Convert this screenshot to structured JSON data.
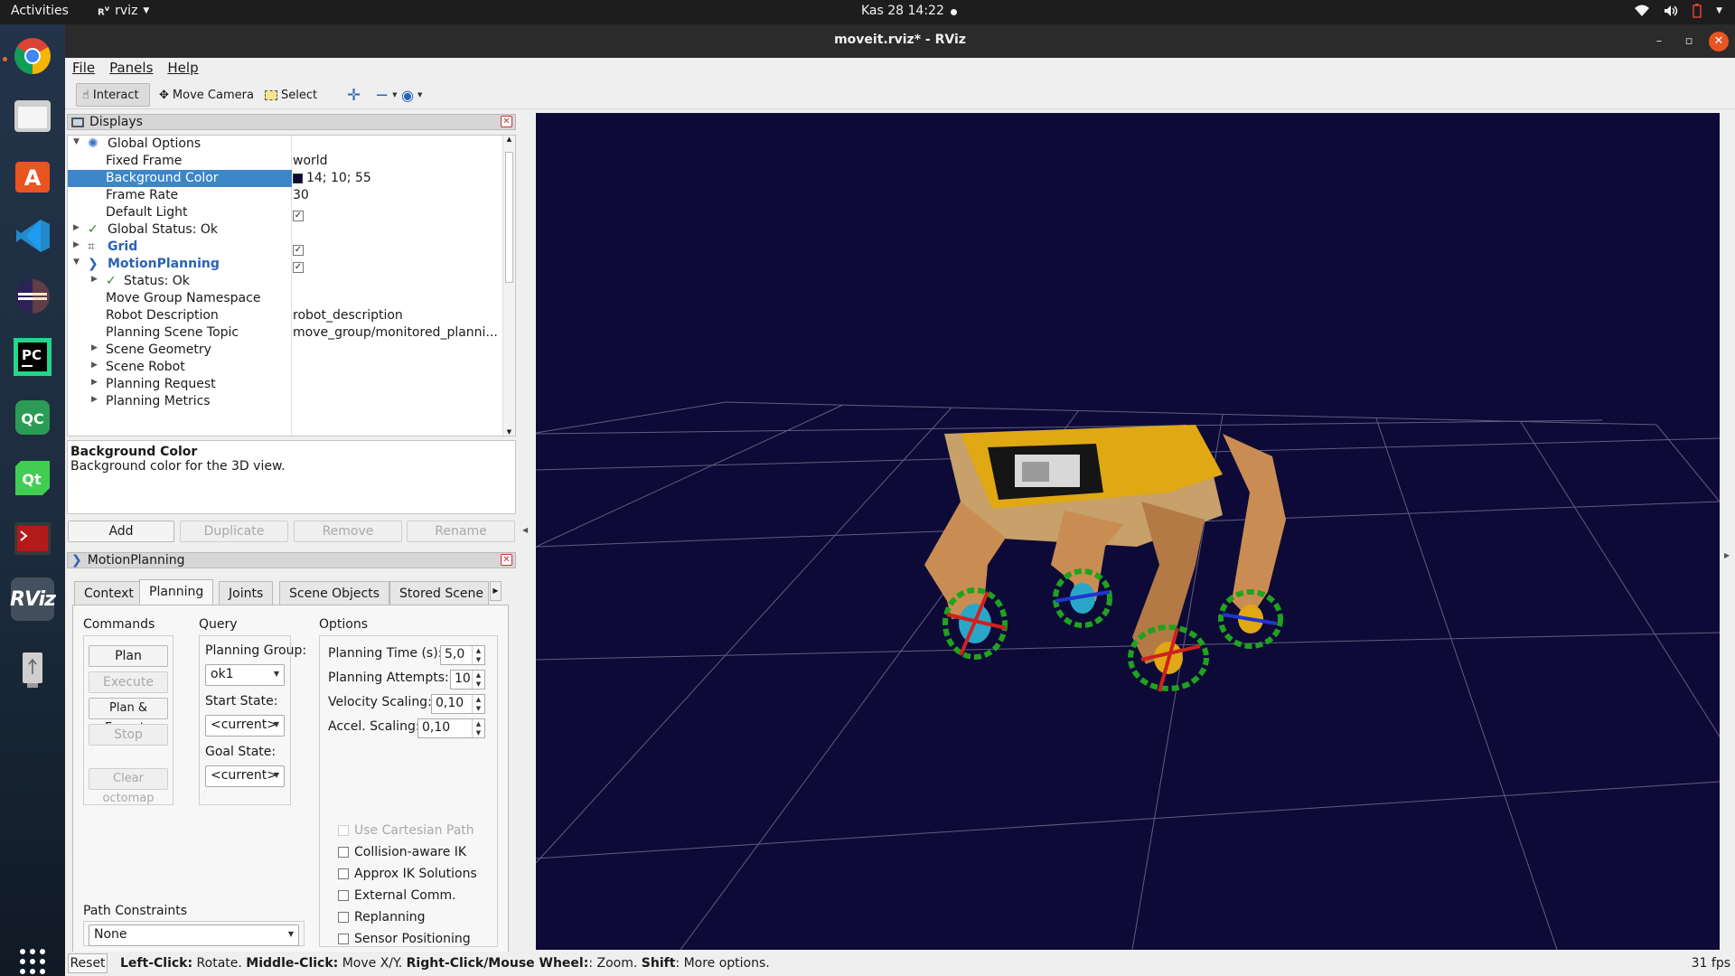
{
  "topbar": {
    "activities": "Activities",
    "app_name": "rviz",
    "clock": "Kas 28  14:22"
  },
  "dock": {
    "items": [
      "Google Chrome",
      "Files",
      "Ubuntu Software",
      "Visual Studio Code",
      "Eclipse",
      "PyCharm",
      "QGroundControl",
      "Qt Creator",
      "Terminal",
      "RViz",
      "USB Drive",
      "Show Applications"
    ]
  },
  "window": {
    "title": "moveit.rviz* - RViz"
  },
  "menu": {
    "file": "File",
    "panels": "Panels",
    "help": "Help"
  },
  "toolbar": {
    "interact": "Interact",
    "move_camera": "Move Camera",
    "select": "Select"
  },
  "displays": {
    "title": "Displays",
    "rows": [
      {
        "label": "Global Options"
      },
      {
        "label": "Fixed Frame",
        "value": "world"
      },
      {
        "label": "Background Color",
        "value": "14; 10; 55"
      },
      {
        "label": "Frame Rate",
        "value": "30"
      },
      {
        "label": "Default Light"
      },
      {
        "label": "Global Status: Ok"
      },
      {
        "label": "Grid"
      },
      {
        "label": "MotionPlanning"
      },
      {
        "label": "Status: Ok"
      },
      {
        "label": "Move Group Namespace"
      },
      {
        "label": "Robot Description",
        "value": "robot_description"
      },
      {
        "label": "Planning Scene Topic",
        "value": "move_group/monitored_planni..."
      },
      {
        "label": "Scene Geometry"
      },
      {
        "label": "Scene Robot"
      },
      {
        "label": "Planning Request"
      },
      {
        "label": "Planning Metrics"
      }
    ],
    "background_swatch": "#0e0a37",
    "description_title": "Background Color",
    "description_text": "Background color for the 3D view.",
    "buttons": {
      "add": "Add",
      "duplicate": "Duplicate",
      "remove": "Remove",
      "rename": "Rename"
    }
  },
  "motion_planning": {
    "title": "MotionPlanning",
    "tabs": [
      "Context",
      "Planning",
      "Joints",
      "Scene Objects",
      "Stored Scene"
    ],
    "commands": {
      "label": "Commands",
      "plan": "Plan",
      "execute": "Execute",
      "plan_execute": "Plan & Execute",
      "stop": "Stop",
      "clear_octomap": "Clear octomap"
    },
    "query": {
      "label": "Query",
      "planning_group_label": "Planning Group:",
      "planning_group": "ok1",
      "start_state_label": "Start State:",
      "start_state": "<current>",
      "goal_state_label": "Goal State:",
      "goal_state": "<current>"
    },
    "options": {
      "label": "Options",
      "planning_time_label": "Planning Time (s):",
      "planning_time": "5,0",
      "planning_attempts_label": "Planning Attempts:",
      "planning_attempts": "10",
      "velocity_scaling_label": "Velocity Scaling:",
      "velocity_scaling": "0,10",
      "accel_scaling_label": "Accel. Scaling:",
      "accel_scaling": "0,10",
      "use_cartesian_path": "Use Cartesian Path",
      "collision_aware_ik": "Collision-aware IK",
      "approx_ik": "Approx IK Solutions",
      "external_comm": "External Comm.",
      "replanning": "Replanning",
      "sensor_positioning": "Sensor Positioning"
    },
    "path_constraints_label": "Path Constraints",
    "path_constraints": "None"
  },
  "statusbar": {
    "reset": "Reset",
    "left_click": "Left-Click:",
    "left_click_action": "Rotate.",
    "middle_click": "Middle-Click:",
    "middle_click_action": "Move X/Y.",
    "right_click": "Right-Click/Mouse Wheel:",
    "right_click_action": ": Zoom.",
    "shift": "Shift",
    "shift_action": ": More options.",
    "fps": "31 fps"
  },
  "colors": {
    "view_background": "#0e0a37",
    "robot_body": "#d9a15b",
    "robot_panel": "#e3a812",
    "selection": "#3d86c7",
    "accent": "#e95420"
  }
}
